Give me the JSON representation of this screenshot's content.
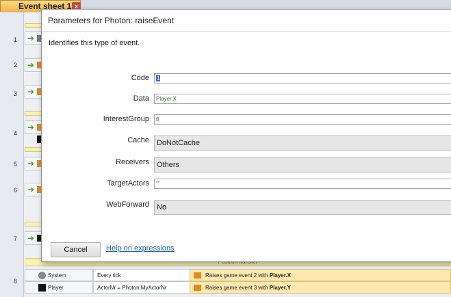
{
  "sheet": {
    "tab_label": "Event sheet 1",
    "tab_close": "x",
    "row_numbers": [
      "1",
      "2",
      "3",
      "4",
      "5",
      "6",
      "7",
      "8"
    ],
    "group_title": "Position transfer",
    "bottom_rows": [
      {
        "object": "System",
        "condition": "Every tick",
        "action_prefix": "Raises game event 2 with ",
        "action_bold": "Player.X"
      },
      {
        "object": "Player",
        "condition": "ActorNr = Photon.MyActorNr",
        "action_prefix": "Raises game event 3 with ",
        "action_bold": "Player.Y"
      }
    ]
  },
  "dialog": {
    "title": "Parameters for Photon: raiseEvent",
    "description": "Identifies this type of event.",
    "params": [
      {
        "label": "Code",
        "value": "1",
        "kind": "text",
        "color": "#1a1aff"
      },
      {
        "label": "Data",
        "value": "Player.X",
        "kind": "text",
        "color": "#1e7a1e"
      },
      {
        "label": "InterestGroup",
        "value": "0",
        "kind": "text",
        "color": "#b01a8c"
      },
      {
        "label": "Cache",
        "value": "DoNotCache",
        "kind": "select"
      },
      {
        "label": "Receivers",
        "value": "Others",
        "kind": "select"
      },
      {
        "label": "TargetActors",
        "value": "\"\"",
        "kind": "text",
        "color": "#c0392b"
      },
      {
        "label": "WebForward",
        "value": "No",
        "kind": "select"
      }
    ],
    "cancel_label": "Cancel",
    "help_label": "Help on expressions"
  }
}
